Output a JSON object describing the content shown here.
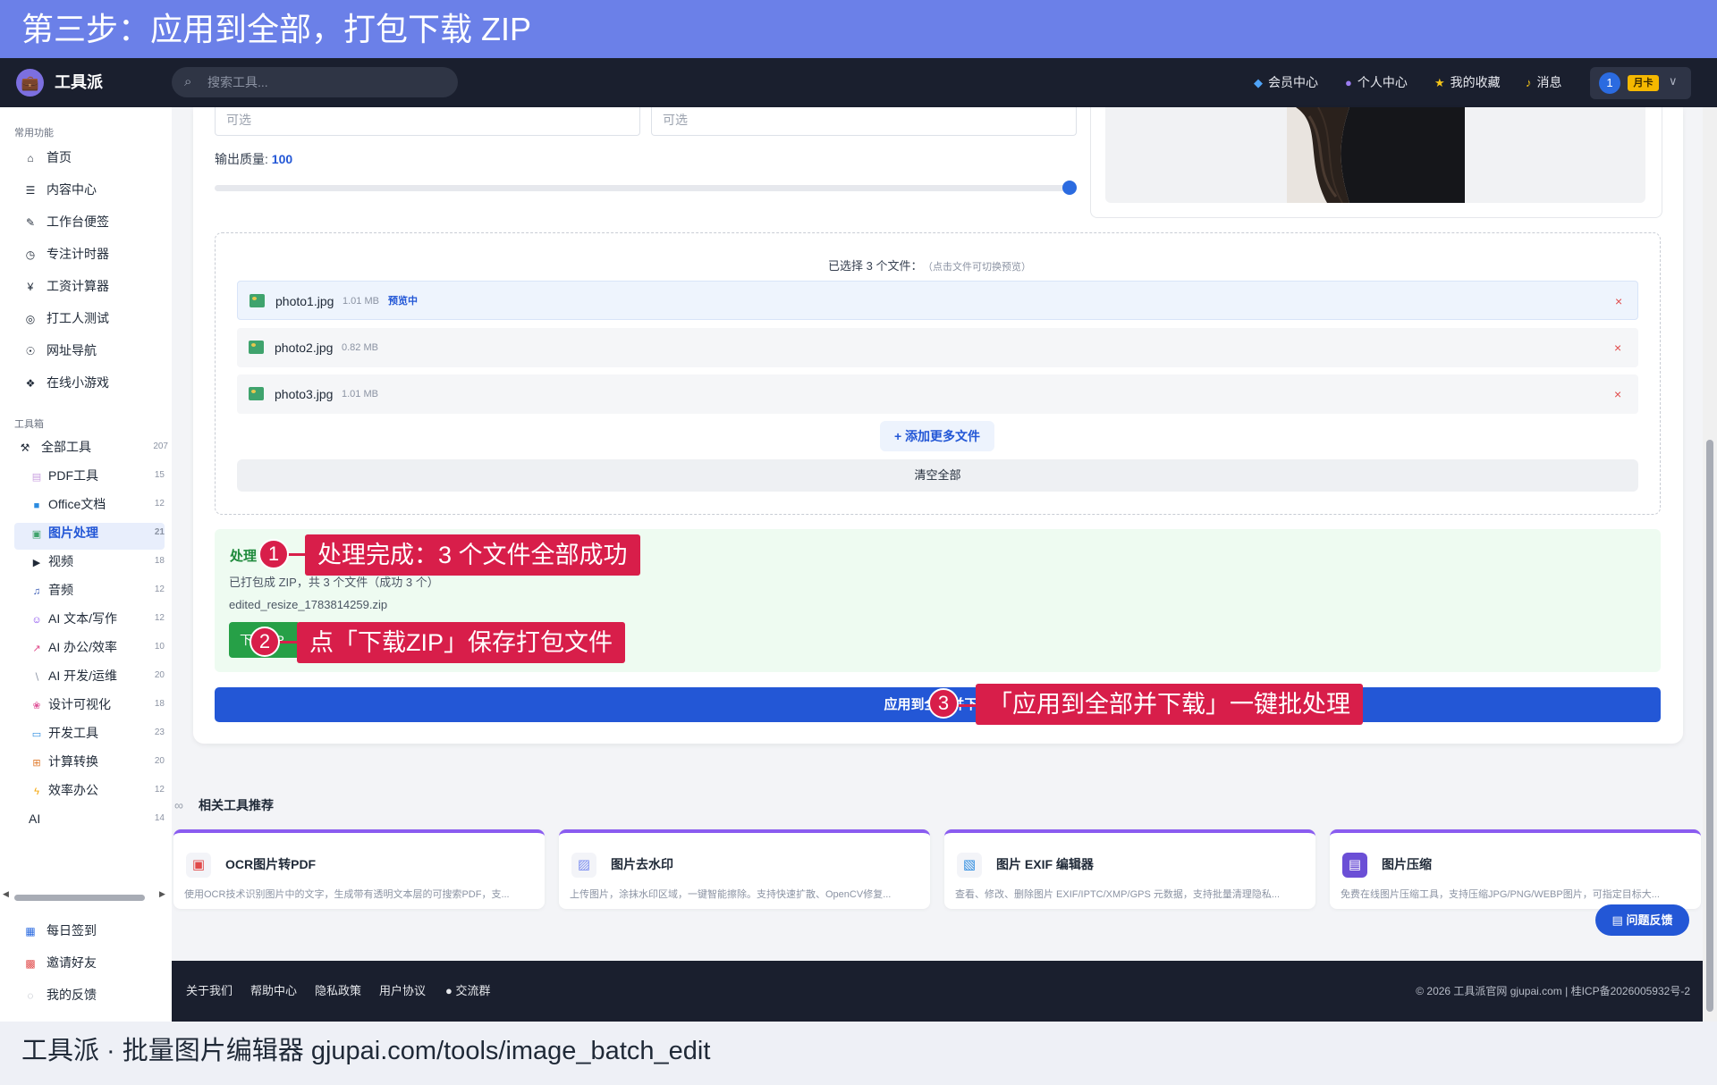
{
  "banner": "第三步：应用到全部，打包下载 ZIP",
  "caption": "工具派 · 批量图片编辑器 gjupai.com/tools/image_batch_edit",
  "header": {
    "brand": "工具派",
    "search_placeholder": "搜索工具...",
    "nav": [
      "会员中心",
      "个人中心",
      "我的收藏",
      "消息"
    ],
    "user_level": "1",
    "user_card": "月卡"
  },
  "sidebar": {
    "common_label": "常用功能",
    "common": [
      "首页",
      "内容中心",
      "工作台便签",
      "专注计时器",
      "工资计算器",
      "打工人测试",
      "网址导航",
      "在线小游戏"
    ],
    "toolbox_label": "工具箱",
    "all_tools": {
      "label": "全部工具",
      "count": "207"
    },
    "categories": [
      {
        "label": "PDF工具",
        "count": "15"
      },
      {
        "label": "Office文档",
        "count": "12"
      },
      {
        "label": "图片处理",
        "count": "21"
      },
      {
        "label": "视频",
        "count": "18"
      },
      {
        "label": "音频",
        "count": "12"
      },
      {
        "label": "AI 文本/写作",
        "count": "12"
      },
      {
        "label": "AI 办公/效率",
        "count": "10"
      },
      {
        "label": "AI 开发/运维",
        "count": "20"
      },
      {
        "label": "设计可视化",
        "count": "18"
      },
      {
        "label": "开发工具",
        "count": "23"
      },
      {
        "label": "计算转换",
        "count": "20"
      },
      {
        "label": "效率办公",
        "count": "12"
      },
      {
        "label": "AI",
        "count": "14"
      }
    ],
    "bottom": [
      "每日签到",
      "邀请好友",
      "我的反馈"
    ]
  },
  "editor": {
    "input1_placeholder": "可选",
    "input2_placeholder": "可选",
    "quality_label": "输出质量:",
    "quality_value": "100",
    "quality_fraction": 1.0
  },
  "files": {
    "title": "已选择 3 个文件：",
    "hint": "（点击文件可切换预览）",
    "items": [
      {
        "name": "photo1.jpg",
        "size": "1.01 MB",
        "tag": "预览中"
      },
      {
        "name": "photo2.jpg",
        "size": "0.82 MB",
        "tag": ""
      },
      {
        "name": "photo3.jpg",
        "size": "1.01 MB",
        "tag": ""
      }
    ],
    "remove_symbol": "×",
    "add_more": "+ 添加更多文件",
    "clear_all": "清空全部"
  },
  "result": {
    "title": "处理",
    "subtitle": "已打包成 ZIP，共 3 个文件（成功 3 个）",
    "filename": "edited_resize_1783814259.zip",
    "download_label": "下载ZIP",
    "apply_label": "应用到全部并下载"
  },
  "annotations": [
    {
      "num": "1",
      "text": "处理完成：3 个文件全部成功"
    },
    {
      "num": "2",
      "text": "点「下载ZIP」保存打包文件"
    },
    {
      "num": "3",
      "text": "「应用到全部并下载」一键批处理"
    }
  ],
  "related": {
    "title": "相关工具推荐",
    "tools": [
      {
        "name": "OCR图片转PDF",
        "desc": "使用OCR技术识别图片中的文字，生成带有透明文本层的可搜索PDF，支..."
      },
      {
        "name": "图片去水印",
        "desc": "上传图片，涂抹水印区域，一键智能擦除。支持快速扩散、OpenCV修复..."
      },
      {
        "name": "图片 EXIF 编辑器",
        "desc": "查看、修改、删除图片 EXIF/IPTC/XMP/GPS 元数据，支持批量清理隐私..."
      },
      {
        "name": "图片压缩",
        "desc": "免费在线图片压缩工具，支持压缩JPG/PNG/WEBP图片，可指定目标大..."
      }
    ]
  },
  "feedback_label": "问题反馈",
  "footer": {
    "links": [
      "关于我们",
      "帮助中心",
      "隐私政策",
      "用户协议",
      "交流群"
    ],
    "copyright": "© 2026 工具派官网 gjupai.com | 桂ICP备2026005932号-2"
  },
  "colors": {
    "accent": "#2357d6",
    "banner": "#6b80e8",
    "annotation": "#d81e4a",
    "success": "#26a047"
  }
}
